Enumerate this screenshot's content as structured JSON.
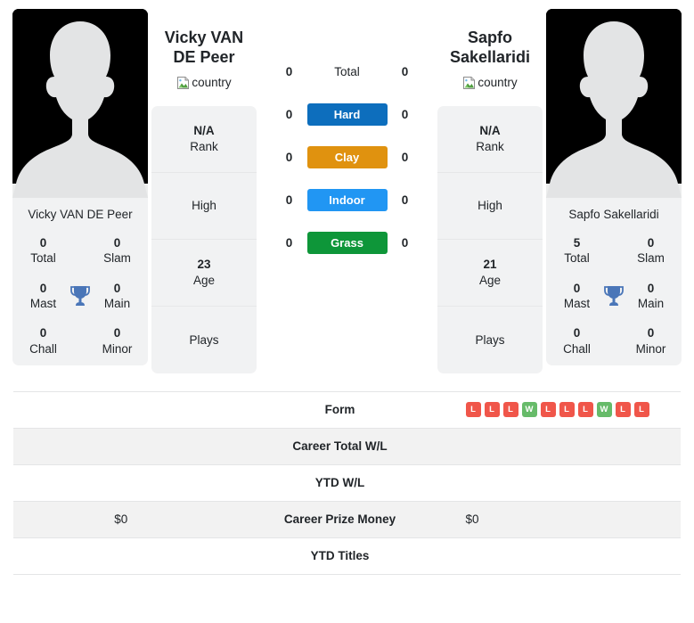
{
  "players": {
    "left": {
      "full_name": "Vicky VAN DE Peer",
      "header_name": "Vicky VAN DE Peer",
      "country_alt": "country",
      "avatar_alt": "player-photo",
      "titles": {
        "total_value": "0",
        "total_label": "Total",
        "slam_value": "0",
        "slam_label": "Slam",
        "mast_value": "0",
        "mast_label": "Mast",
        "main_value": "0",
        "main_label": "Main",
        "chall_value": "0",
        "chall_label": "Chall",
        "minor_value": "0",
        "minor_label": "Minor"
      },
      "info": {
        "rank_value": "N/A",
        "rank_label": "Rank",
        "high_value": "",
        "high_label": "High",
        "age_value": "23",
        "age_label": "Age",
        "plays_value": "",
        "plays_label": "Plays"
      },
      "surfaces": {
        "total": "0",
        "hard": "0",
        "clay": "0",
        "indoor": "0",
        "grass": "0"
      },
      "table": {
        "form": [],
        "career_total_wl": "",
        "ytd_wl": "",
        "career_prize_money": "$0",
        "ytd_titles": ""
      }
    },
    "right": {
      "full_name": "Sapfo Sakellaridi",
      "header_name": "Sapfo Sakellaridi",
      "country_alt": "country",
      "avatar_alt": "player-photo",
      "titles": {
        "total_value": "5",
        "total_label": "Total",
        "slam_value": "0",
        "slam_label": "Slam",
        "mast_value": "0",
        "mast_label": "Mast",
        "main_value": "0",
        "main_label": "Main",
        "chall_value": "0",
        "chall_label": "Chall",
        "minor_value": "0",
        "minor_label": "Minor"
      },
      "info": {
        "rank_value": "N/A",
        "rank_label": "Rank",
        "high_value": "",
        "high_label": "High",
        "age_value": "21",
        "age_label": "Age",
        "plays_value": "",
        "plays_label": "Plays"
      },
      "surfaces": {
        "total": "0",
        "hard": "0",
        "clay": "0",
        "indoor": "0",
        "grass": "0"
      },
      "table": {
        "form": [
          "L",
          "L",
          "L",
          "W",
          "L",
          "L",
          "L",
          "W",
          "L",
          "L"
        ],
        "career_total_wl": "",
        "ytd_wl": "",
        "career_prize_money": "$0",
        "ytd_titles": ""
      }
    }
  },
  "surface_rows": {
    "total_label": "Total",
    "hard_label": "Hard",
    "clay_label": "Clay",
    "indoor_label": "Indoor",
    "grass_label": "Grass"
  },
  "table_labels": {
    "form": "Form",
    "career_total_wl": "Career Total W/L",
    "ytd_wl": "YTD W/L",
    "career_prize_money": "Career Prize Money",
    "ytd_titles": "YTD Titles"
  },
  "colors": {
    "hard": "#0d6ebd",
    "clay": "#e0920f",
    "indoor": "#2196f3",
    "grass": "#0e9639",
    "win": "#67bb6a",
    "loss": "#f0564a",
    "trophy": "#4a76b8",
    "card_bg": "#f1f2f3",
    "row_alt_bg": "#f2f2f2"
  }
}
